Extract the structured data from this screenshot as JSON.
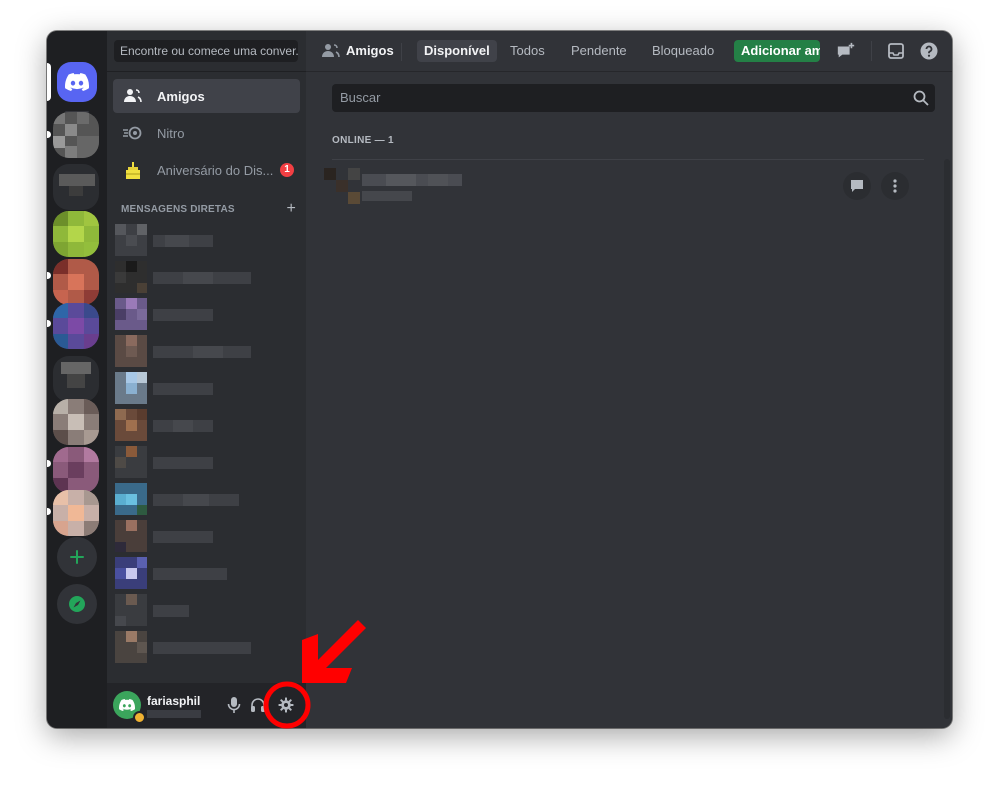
{
  "search_dm": {
    "placeholder": "Encontre ou comece uma conver..."
  },
  "nav": [
    {
      "label": "Amigos",
      "icon": "friends-icon",
      "active": true
    },
    {
      "label": "Nitro",
      "icon": "nitro-icon"
    },
    {
      "label": "Aniversário do Dis...",
      "icon": "birthday-cake-icon",
      "badge": "1"
    }
  ],
  "dm": {
    "header": "MENSAGENS DIRETAS",
    "add": "+"
  },
  "user": {
    "name": "fariasphil",
    "status_color": "#f0b232"
  },
  "topbar": {
    "title": "Amigos",
    "tabs": [
      "Disponível",
      "Todos",
      "Pendente",
      "Bloqueado"
    ],
    "active_tab": "Disponível",
    "add_friend": "Adicionar amigo"
  },
  "main": {
    "search_placeholder": "Buscar",
    "online_header": "ONLINE — 1"
  },
  "colors": {
    "brand": "#5865f2",
    "add_friend_bg": "#248046",
    "badge": "#f23f43",
    "annotation": "#ff0000"
  }
}
